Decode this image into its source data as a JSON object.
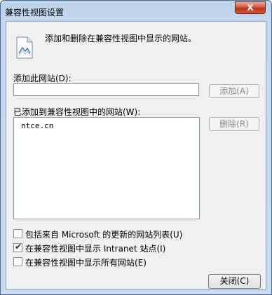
{
  "window": {
    "title": "兼容性视图设置",
    "close_glyph": "X"
  },
  "intro": {
    "text": "添加和删除在兼容性视图中显示的网站。",
    "icon": "document-icon"
  },
  "add_site": {
    "label": "添加此网站(D):",
    "value": "",
    "button_label": "添加(A)"
  },
  "site_list": {
    "label": "已添加到兼容性视图中的网站(W):",
    "items": [
      "ntce.cn"
    ],
    "delete_label": "删除(R)"
  },
  "options": [
    {
      "label": "包括来自 Microsoft 的更新的网站列表(U)",
      "checked": false
    },
    {
      "label": "在兼容性视图中显示 Intranet 站点(I)",
      "checked": true
    },
    {
      "label": "在兼容性视图中显示所有网站(E)",
      "checked": false
    }
  ],
  "close_button": {
    "label": "关闭(C)"
  }
}
